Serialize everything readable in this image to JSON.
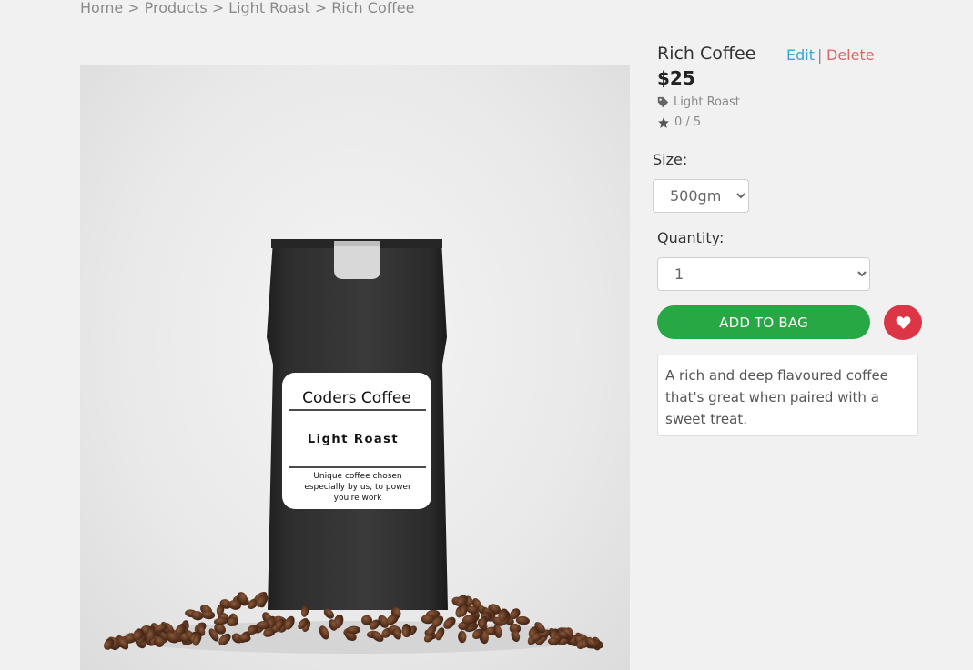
{
  "breadcrumb": {
    "items": [
      "Home",
      "Products",
      "Light Roast",
      "Rich Coffee"
    ],
    "separator": ">"
  },
  "product": {
    "title": "Rich Coffee",
    "price": "$25",
    "category": "Light Roast",
    "rating": "0 / 5",
    "description": "A rich and deep flavoured coffee that's great when paired with a sweet treat.",
    "edit_label": "Edit",
    "divider": "|",
    "delete_label": "Delete"
  },
  "bag_label": {
    "brand": "Coders Coffee",
    "roast": "Light Roast",
    "tagline_1": "Unique coffee chosen",
    "tagline_2": "especially by us, to power",
    "tagline_3": "you're work"
  },
  "size": {
    "label": "Size:",
    "selected": "500gm"
  },
  "quantity": {
    "label": "Quantity:",
    "selected": "1"
  },
  "actions": {
    "add_to_bag": "ADD TO BAG",
    "wishlist_icon": "heart-icon"
  },
  "icons": {
    "category": "tag-icon",
    "rating": "star-icon"
  },
  "colors": {
    "background": "#f1f1f1",
    "link": "#3ea0d8",
    "delete": "#e06464",
    "add_button": "#28a745",
    "wishlist_button": "#dc3545"
  }
}
